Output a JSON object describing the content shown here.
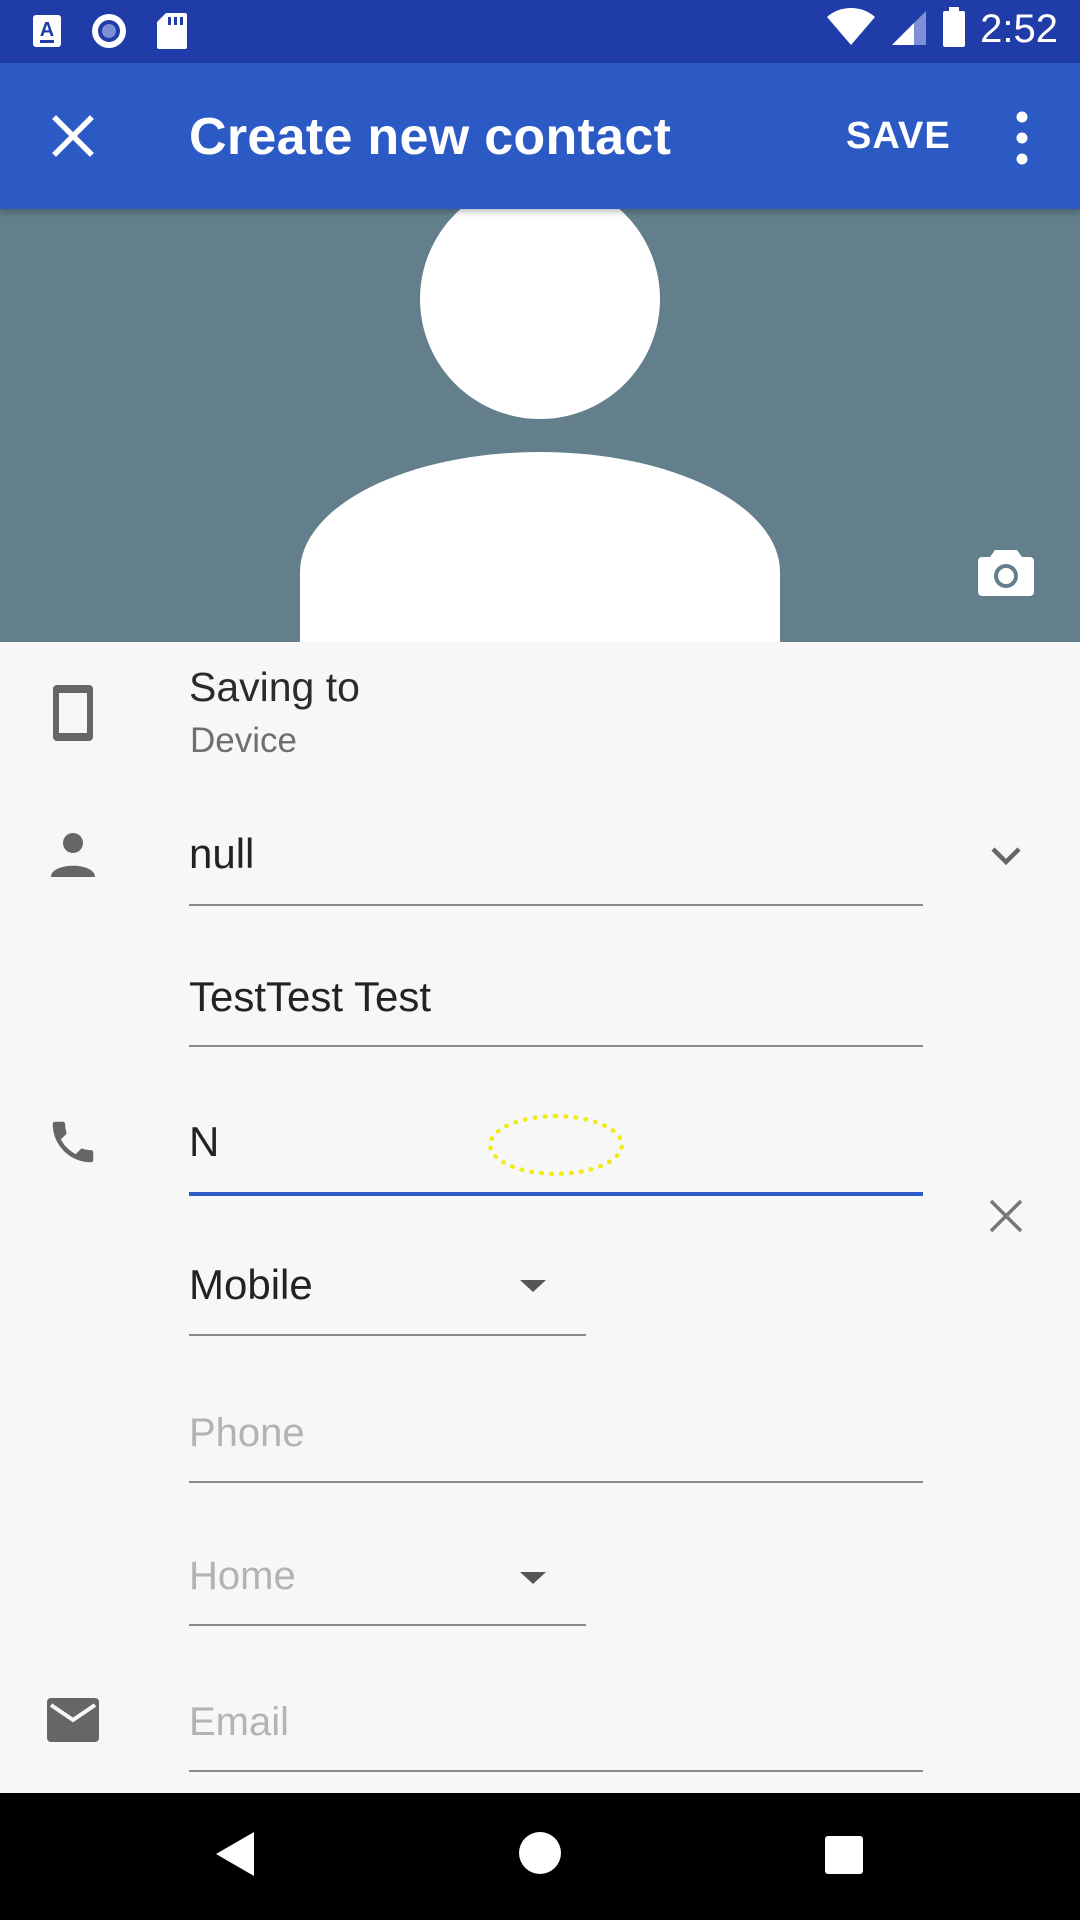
{
  "status_bar": {
    "time": "2:52",
    "icons": [
      "font-app-icon",
      "record-icon",
      "sd-card-icon",
      "wifi-icon",
      "signal-icon",
      "battery-icon"
    ]
  },
  "app_bar": {
    "title": "Create new contact",
    "save_label": "SAVE",
    "close_icon": "close-icon",
    "more_icon": "more-vert-icon",
    "background": "#2c5ac5"
  },
  "photo": {
    "background": "#627f8b",
    "camera_icon": "camera-icon"
  },
  "account": {
    "label": "Saving to",
    "value": "Device",
    "icon": "phone-device-icon"
  },
  "name": {
    "value": "null",
    "icon": "person-icon",
    "expand_icon": "chevron-down-icon"
  },
  "full_name": {
    "value": "TestTest Test"
  },
  "phone": {
    "value": "N",
    "icon": "phone-icon",
    "clear_icon": "clear-icon",
    "type": "Mobile",
    "accent": "#2c5ac5"
  },
  "phone2": {
    "placeholder": "Phone",
    "type": "Home"
  },
  "email": {
    "placeholder": "Email",
    "icon": "email-icon"
  },
  "nav_bar": {
    "icons": [
      "back-icon",
      "home-icon",
      "recents-icon"
    ]
  }
}
